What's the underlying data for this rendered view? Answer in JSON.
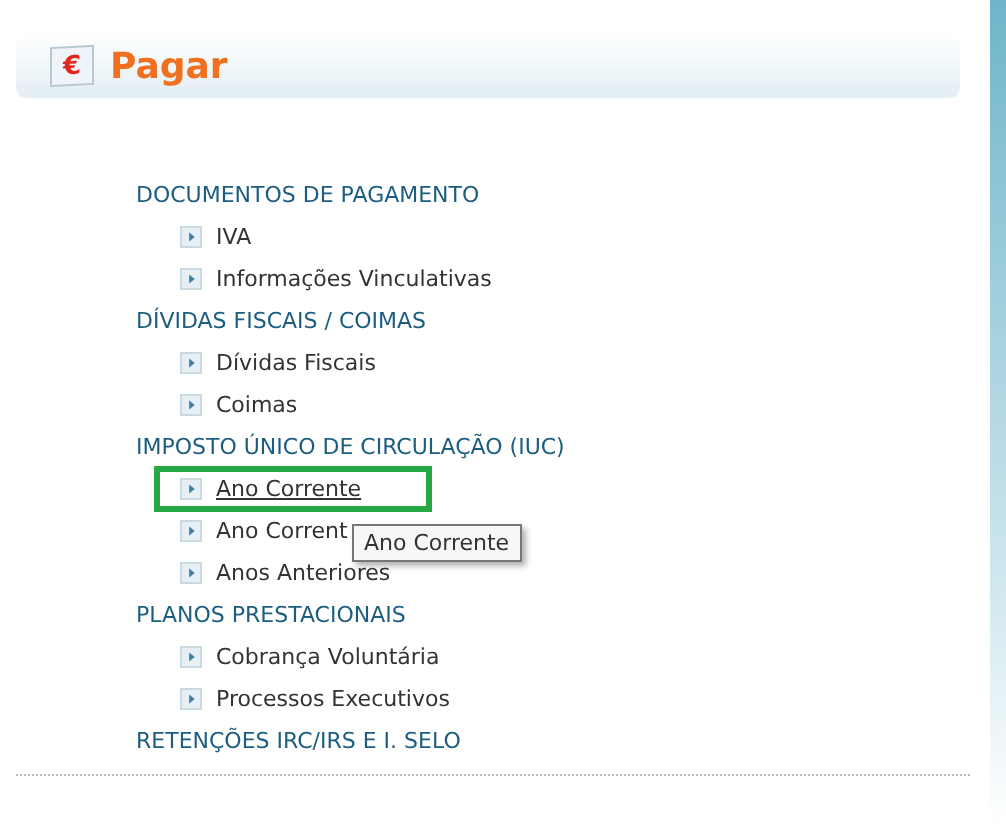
{
  "header": {
    "title": "Pagar",
    "icon_text": "€"
  },
  "sections": [
    {
      "title": "DOCUMENTOS DE PAGAMENTO",
      "items": [
        {
          "label": "IVA",
          "highlighted": false
        },
        {
          "label": "Informações Vinculativas",
          "highlighted": false
        }
      ]
    },
    {
      "title": "DÍVIDAS FISCAIS / COIMAS",
      "items": [
        {
          "label": "Dívidas Fiscais",
          "highlighted": false
        },
        {
          "label": "Coimas",
          "highlighted": false
        }
      ]
    },
    {
      "title": "IMPOSTO ÚNICO DE CIRCULAÇÃO (IUC)",
      "items": [
        {
          "label": "Ano Corrente",
          "highlighted": true
        },
        {
          "label": "Ano Corrent",
          "highlighted": false
        },
        {
          "label": "Anos Anteriores",
          "highlighted": false
        }
      ]
    },
    {
      "title": "PLANOS PRESTACIONAIS",
      "items": [
        {
          "label": "Cobrança Voluntária",
          "highlighted": false
        },
        {
          "label": "Processos Executivos",
          "highlighted": false
        }
      ]
    },
    {
      "title": "RETENÇÕES IRC/IRS E I. SELO"
    }
  ],
  "tooltip": {
    "text": "Ano Corrente"
  }
}
